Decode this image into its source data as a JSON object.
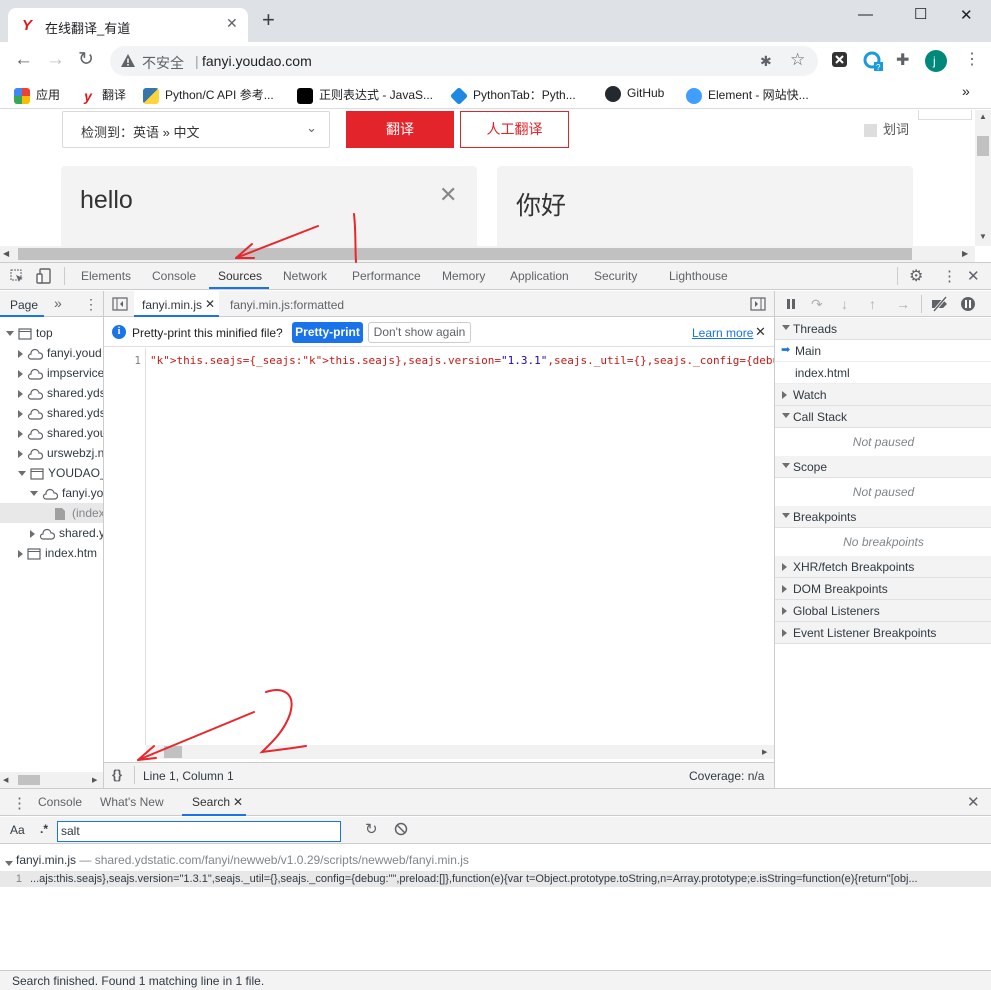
{
  "browser": {
    "tab_title": "在线翻译_有道",
    "tab_favicon": "Y",
    "new_tab": "+",
    "address": {
      "security": "不安全",
      "url": "fanyi.youdao.com"
    },
    "profile_initial": "j",
    "bookmarks": [
      {
        "label": "应用",
        "icon": "apps-icon",
        "color": "#ea4335"
      },
      {
        "label": "翻译",
        "icon": "youdao-icon",
        "color": "#e0181b"
      },
      {
        "label": "Python/C API 参考...",
        "icon": "python-icon",
        "color": "#3776ab"
      },
      {
        "label": "正则表达式 - JavaS...",
        "icon": "mdn-icon",
        "color": "#000000"
      },
      {
        "label": "PythonTab：Pyth...",
        "icon": "pythontab-icon",
        "color": "#1e88e5"
      },
      {
        "label": "GitHub",
        "icon": "github-icon",
        "color": "#24292e"
      },
      {
        "label": "Element - 网站快...",
        "icon": "element-icon",
        "color": "#409eff"
      }
    ]
  },
  "page": {
    "detect_label": "检测到：英语 » 中文",
    "translate_btn": "翻译",
    "human_btn": "人工翻译",
    "huaci": "划词",
    "source_text": "hello",
    "result_text": "你好"
  },
  "devtools": {
    "tabs": [
      "Elements",
      "Console",
      "Sources",
      "Network",
      "Performance",
      "Memory",
      "Application",
      "Security",
      "Lighthouse"
    ],
    "active_tab": "Sources",
    "navigator": {
      "tab": "Page",
      "tree": [
        {
          "label": "top",
          "level": 0,
          "icon": "frame",
          "open": true
        },
        {
          "label": "fanyi.youd",
          "level": 1,
          "icon": "cloud",
          "open": false
        },
        {
          "label": "impservice",
          "level": 1,
          "icon": "cloud",
          "open": false
        },
        {
          "label": "shared.yds",
          "level": 1,
          "icon": "cloud",
          "open": false
        },
        {
          "label": "shared.yds",
          "level": 1,
          "icon": "cloud",
          "open": false
        },
        {
          "label": "shared.you",
          "level": 1,
          "icon": "cloud",
          "open": false
        },
        {
          "label": "urswebzj.n",
          "level": 1,
          "icon": "cloud",
          "open": false
        },
        {
          "label": "YOUDAO_",
          "level": 1,
          "icon": "frame",
          "open": true
        },
        {
          "label": "fanyi.yo",
          "level": 2,
          "icon": "cloud",
          "open": true
        },
        {
          "label": "(index",
          "level": 3,
          "icon": "file",
          "open": null
        },
        {
          "label": "shared.y",
          "level": 2,
          "icon": "cloud",
          "open": false
        },
        {
          "label": "index.htm",
          "level": 1,
          "icon": "frame",
          "open": false
        }
      ]
    },
    "editor": {
      "tabs": [
        {
          "label": "fanyi.min.js",
          "closable": true
        },
        {
          "label": "fanyi.min.js:formatted",
          "closable": false
        }
      ],
      "infobar": {
        "message": "Pretty-print this minified file?",
        "primary": "Pretty-print",
        "secondary": "Don't show again",
        "link": "Learn more"
      },
      "line_number": "1",
      "code_line": "this.seajs={_seajs:this.seajs},seajs.version=\"1.3.1\",seajs._util={},seajs._config={debug:\"\",pre",
      "status_left": "Line 1, Column 1",
      "status_right": "Coverage: n/a",
      "format_icon": "{}"
    },
    "debugger": {
      "sections": [
        {
          "title": "Threads",
          "open": true
        },
        {
          "title": "Watch",
          "open": false
        },
        {
          "title": "Call Stack",
          "open": true,
          "note": "Not paused"
        },
        {
          "title": "Scope",
          "open": true,
          "note": "Not paused"
        },
        {
          "title": "Breakpoints",
          "open": true,
          "note": "No breakpoints"
        },
        {
          "title": "XHR/fetch Breakpoints",
          "open": false
        },
        {
          "title": "DOM Breakpoints",
          "open": false
        },
        {
          "title": "Global Listeners",
          "open": false
        },
        {
          "title": "Event Listener Breakpoints",
          "open": false
        }
      ],
      "threads": [
        "Main",
        "index.html"
      ]
    },
    "drawer": {
      "tabs": [
        "Console",
        "What's New",
        "Search"
      ],
      "active_tab": "Search",
      "case_toggle": "Aa",
      "regex_toggle": ".*",
      "query": "salt",
      "result_file": "fanyi.min.js",
      "result_path": "— shared.ydstatic.com/fanyi/newweb/v1.0.29/scripts/newweb/fanyi.min.js",
      "result_line_no": "1",
      "result_line": "...ajs:this.seajs},seajs.version=\"1.3.1\",seajs._util={},seajs._config={debug:\"\",preload:[]},function(e){var t=Object.prototype.toString,n=Array.prototype;e.isString=function(e){return\"[obj...",
      "status": "Search finished.  Found 1 matching line in 1 file."
    }
  },
  "colors": {
    "youdao_red": "#e3242b",
    "accent_blue": "#1a73e8",
    "annotation_red": "#e8262b"
  }
}
